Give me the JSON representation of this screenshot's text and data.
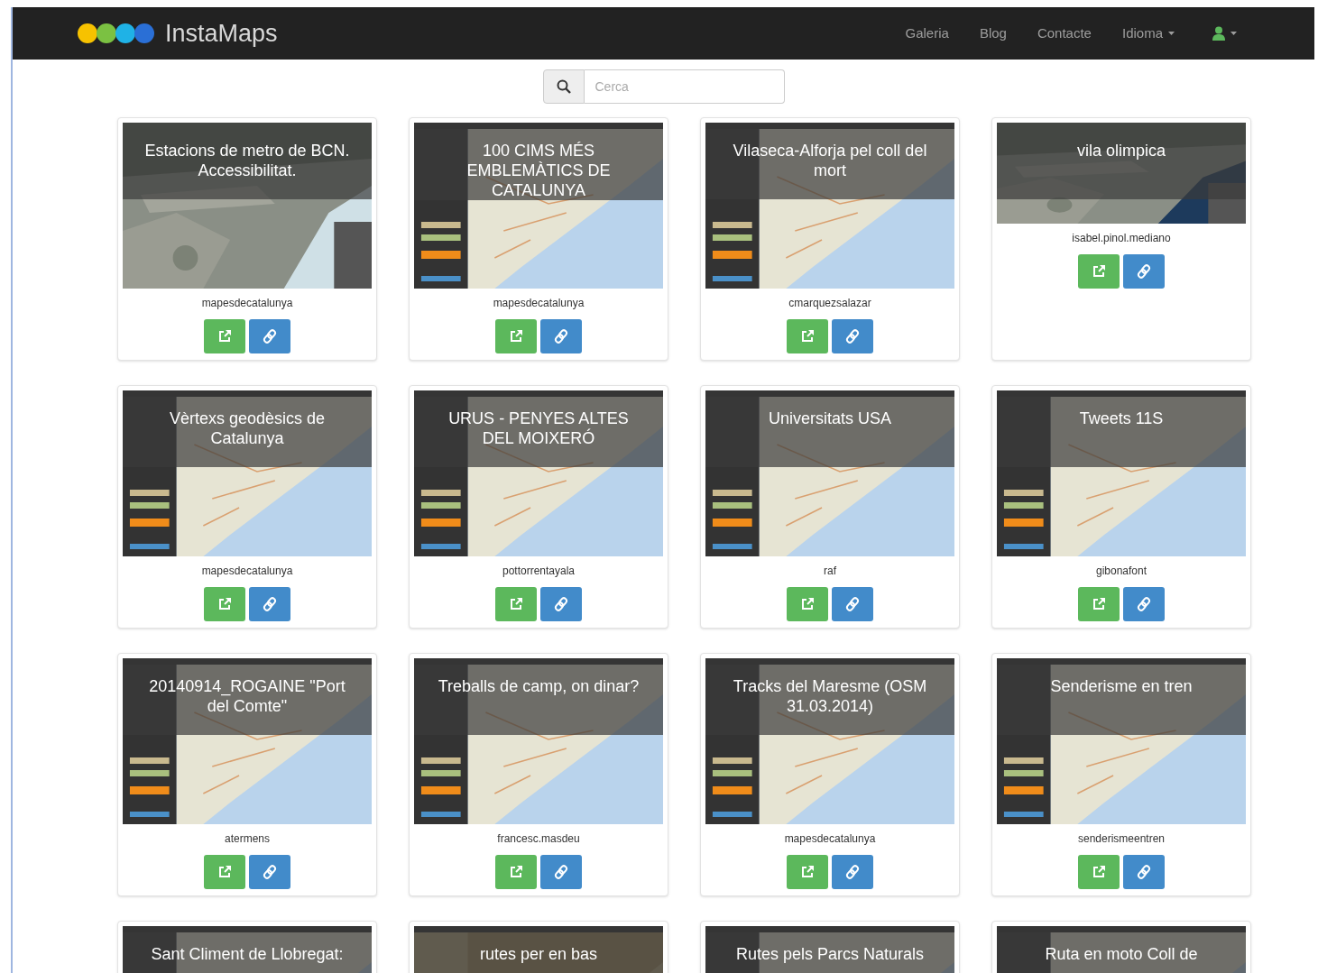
{
  "navbar": {
    "brand": "InstaMaps",
    "links": [
      {
        "label": "Galeria",
        "dropdown": false
      },
      {
        "label": "Blog",
        "dropdown": false
      },
      {
        "label": "Contacte",
        "dropdown": false
      },
      {
        "label": "Idioma",
        "dropdown": true
      }
    ]
  },
  "search": {
    "placeholder": "Cerca"
  },
  "maps": [
    {
      "title": "Estacions de metro de BCN. Accessibilitat.",
      "author": "mapesdecatalunya"
    },
    {
      "title": "100 CIMS MÉS EMBLEMÀTICS DE CATALUNYA",
      "author": "mapesdecatalunya"
    },
    {
      "title": "Vilaseca-Alforja pel coll del mort",
      "author": "cmarquezsalazar"
    },
    {
      "title": "vila olimpica",
      "author": "isabel.pinol.mediano"
    },
    {
      "title": "Vèrtexs geodèsics de Catalunya",
      "author": "mapesdecatalunya"
    },
    {
      "title": "URUS - PENYES ALTES DEL MOIXERÓ",
      "author": "pottorrentayala"
    },
    {
      "title": "Universitats USA",
      "author": "raf"
    },
    {
      "title": "Tweets 11S",
      "author": "gibonafont"
    },
    {
      "title": "20140914_ROGAINE \"Port del Comte\"",
      "author": "atermens"
    },
    {
      "title": "Treballs de camp, on dinar?",
      "author": "francesc.masdeu"
    },
    {
      "title": "Tracks del Maresme (OSM 31.03.2014)",
      "author": "mapesdecatalunya"
    },
    {
      "title": "Senderisme en tren",
      "author": "senderismeentren"
    },
    {
      "title": "Sant Climent de Llobregat:"
    },
    {
      "title": "rutes per en bas"
    },
    {
      "title": "Rutes pels Parcs Naturals"
    },
    {
      "title": "Ruta en moto Coll de"
    }
  ]
}
